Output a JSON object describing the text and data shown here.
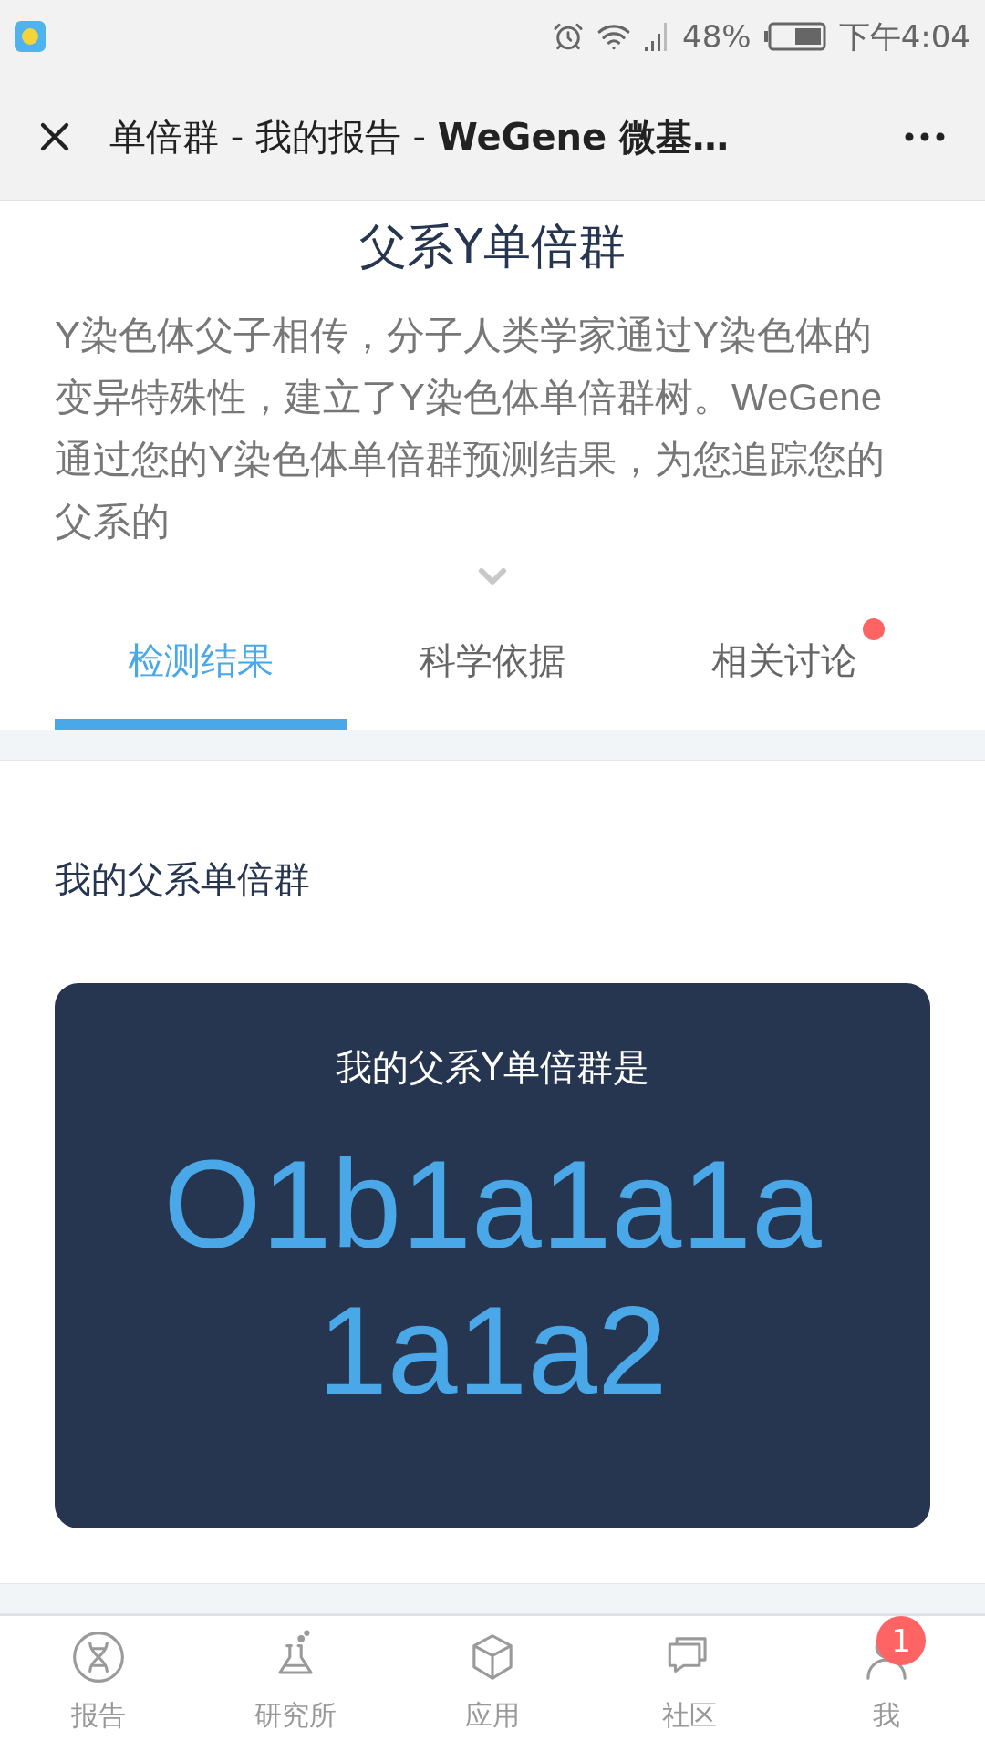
{
  "status_bar": {
    "battery_text": "48%",
    "time": "下午4:04"
  },
  "header": {
    "title": "单倍群 - 我的报告 - **WeGene 微基…**"
  },
  "intro": {
    "title": "父系Y单倍群",
    "text": "Y染色体父子相传，分子人类学家通过Y染色体的变异特殊性，建立了Y染色体单倍群树。WeGene通过您的Y染色体单倍群预测结果，为您追踪您的父系的",
    "expanded": false
  },
  "tabs": [
    {
      "label": "检测结果",
      "selected": true,
      "unread": false
    },
    {
      "label": "科学依据",
      "selected": false,
      "unread": false
    },
    {
      "label": "相关讨论",
      "selected": false,
      "unread": true
    }
  ],
  "section": {
    "heading": "我的父系单倍群",
    "card_title": "我的父系Y单倍群是",
    "haplogroup": "O1b1a1a1a1a1a2"
  },
  "bottom_nav": [
    {
      "kind": "dna",
      "label": "报告"
    },
    {
      "kind": "flask",
      "label": "研究所"
    },
    {
      "kind": "cube",
      "label": "应用"
    },
    {
      "kind": "chat",
      "label": "社区"
    },
    {
      "kind": "user",
      "label": "我",
      "badge": "1"
    }
  ]
}
